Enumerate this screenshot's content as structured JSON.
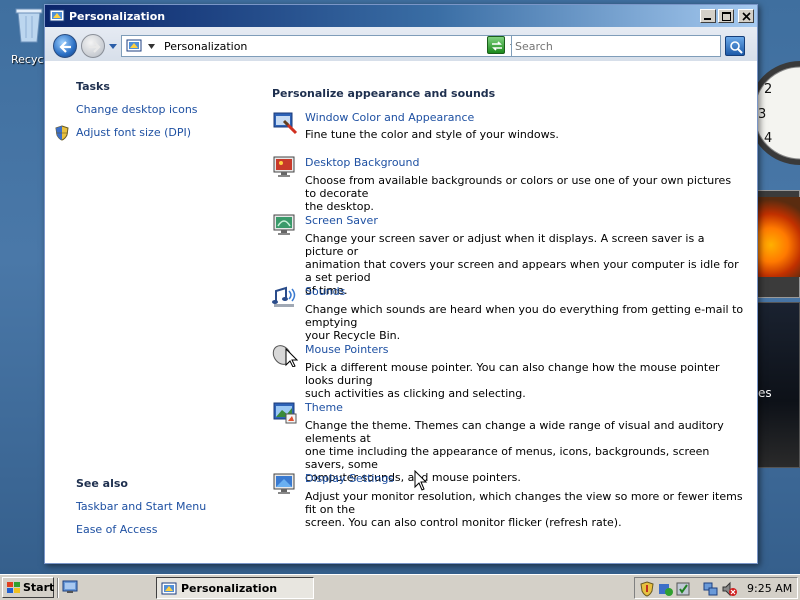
{
  "desktop": {
    "recycle_bin_label": "Recyc",
    "gadget_text": "es"
  },
  "window": {
    "title": "Personalization",
    "address": "Personalization",
    "search_placeholder": "Search"
  },
  "left_pane": {
    "tasks_heading": "Tasks",
    "tasks": [
      {
        "label": "Change desktop icons"
      },
      {
        "label": "Adjust font size (DPI)"
      }
    ],
    "see_also_heading": "See also",
    "see_also": [
      {
        "label": "Taskbar and Start Menu"
      },
      {
        "label": "Ease of Access"
      }
    ]
  },
  "main": {
    "heading": "Personalize appearance and sounds",
    "items": [
      {
        "title": "Window Color and Appearance",
        "desc": [
          "Fine tune the color and style of your windows."
        ],
        "icon": "window-color-icon"
      },
      {
        "title": "Desktop Background",
        "desc": [
          "Choose from available backgrounds or colors or use one of your own pictures to decorate",
          "the desktop."
        ],
        "icon": "desktop-background-icon"
      },
      {
        "title": "Screen Saver",
        "desc": [
          "Change your screen saver or adjust when it displays. A screen saver is a picture or",
          "animation that covers your screen and appears when your computer is idle for a set period",
          "of time."
        ],
        "icon": "screen-saver-icon"
      },
      {
        "title": "Sounds",
        "desc": [
          "Change which sounds are heard when you do everything from getting e-mail to emptying",
          "your Recycle Bin."
        ],
        "icon": "sounds-icon"
      },
      {
        "title": "Mouse Pointers",
        "desc": [
          "Pick a different mouse pointer. You can also change how the mouse pointer looks during",
          "such activities as clicking and selecting."
        ],
        "icon": "mouse-pointers-icon"
      },
      {
        "title": "Theme",
        "desc": [
          "Change the theme. Themes can change a wide range of visual and auditory elements at",
          "one time including the appearance of menus, icons, backgrounds, screen savers, some",
          "computer sounds, and mouse pointers."
        ],
        "icon": "theme-icon"
      },
      {
        "title": "Display Settings",
        "desc": [
          "Adjust your monitor resolution, which changes the view so more or fewer items fit on the",
          "screen. You can also control monitor flicker (refresh rate)."
        ],
        "icon": "display-settings-icon"
      }
    ]
  },
  "taskbar": {
    "start_label": "Start",
    "task_label": "Personalization",
    "clock": "9:25 AM"
  },
  "clock_gadget": {
    "numerals": [
      "2",
      "3",
      "4"
    ]
  },
  "colors": {
    "link": "#1e50a2",
    "heading": "#1e2f4e",
    "titlebar_start": "#0a246a",
    "titlebar_end": "#a6caf0"
  }
}
